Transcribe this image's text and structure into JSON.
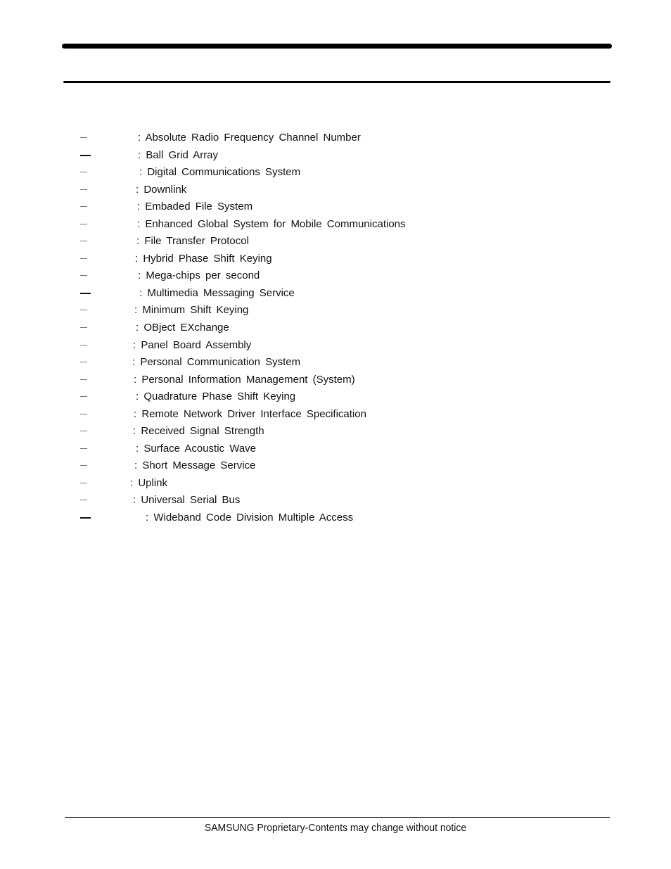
{
  "document": {
    "abbreviations": [
      {
        "abbr": "",
        "definition": ": Absolute Radio Frequency Channel Number",
        "dash": "thin"
      },
      {
        "abbr": "",
        "definition": ": Ball Grid Array",
        "dash": "bold"
      },
      {
        "abbr": "",
        "definition": ": Digital Communications System",
        "dash": "thin"
      },
      {
        "abbr": "",
        "definition": ": Downlink",
        "dash": "thin"
      },
      {
        "abbr": "",
        "definition": ": Embaded File System",
        "dash": "thin"
      },
      {
        "abbr": "",
        "definition": ": Enhanced Global System for Mobile Communications",
        "dash": "thin"
      },
      {
        "abbr": "",
        "definition": ": File Transfer Protocol",
        "dash": "thin"
      },
      {
        "abbr": "",
        "definition": ": Hybrid Phase Shift Keying",
        "dash": "thin"
      },
      {
        "abbr": "",
        "definition": ": Mega-chips per second",
        "dash": "thin"
      },
      {
        "abbr": "",
        "definition": ": Multimedia Messaging Service",
        "dash": "bold"
      },
      {
        "abbr": "",
        "definition": ": Minimum Shift Keying",
        "dash": "thin"
      },
      {
        "abbr": "",
        "definition": ": OBject EXchange",
        "dash": "thin"
      },
      {
        "abbr": "",
        "definition": ": Panel Board Assembly",
        "dash": "thin"
      },
      {
        "abbr": "",
        "definition": ": Personal Communication System",
        "dash": "thin"
      },
      {
        "abbr": "",
        "definition": ": Personal Information Management (System)",
        "dash": "thin"
      },
      {
        "abbr": "",
        "definition": ": Quadrature Phase Shift Keying",
        "dash": "thin"
      },
      {
        "abbr": "",
        "definition": ": Remote Network Driver Interface Specification",
        "dash": "thin"
      },
      {
        "abbr": "",
        "definition": ": Received Signal Strength",
        "dash": "thin"
      },
      {
        "abbr": "",
        "definition": ": Surface Acoustic Wave",
        "dash": "thin"
      },
      {
        "abbr": "",
        "definition": ": Short Message Service",
        "dash": "thin"
      },
      {
        "abbr": "",
        "definition": ": Uplink",
        "dash": "thin"
      },
      {
        "abbr": "",
        "definition": ": Universal Serial Bus",
        "dash": "thin"
      },
      {
        "abbr": "",
        "definition": ": Wideband Code Division Multiple Access",
        "dash": "bold"
      }
    ],
    "footer": "SAMSUNG Proprietary-Contents may change without notice"
  }
}
